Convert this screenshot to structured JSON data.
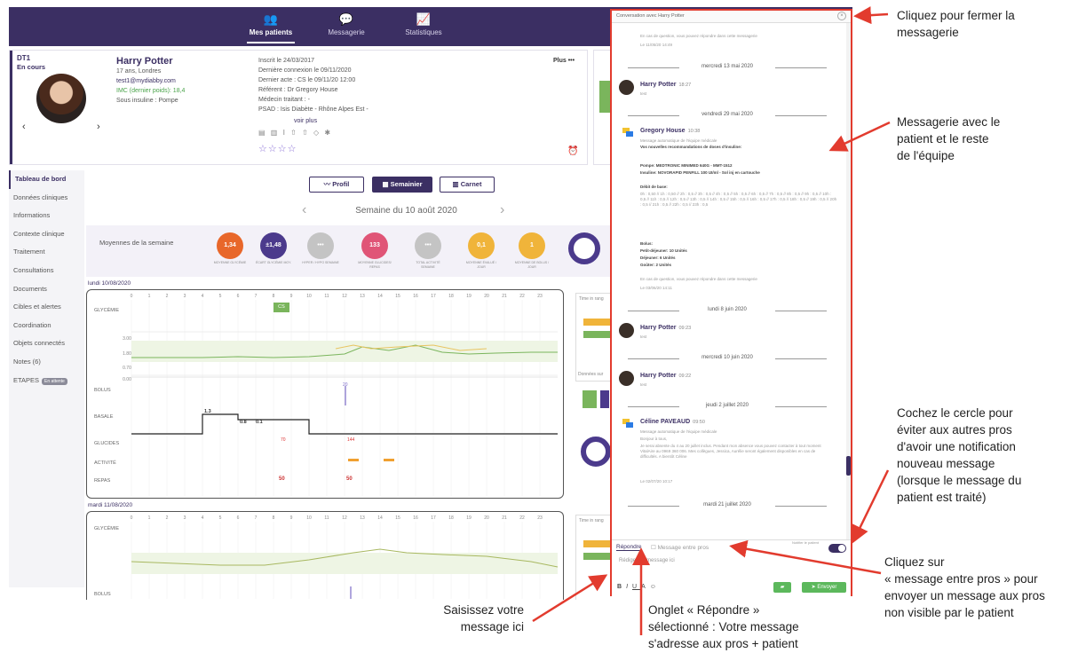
{
  "nav": {
    "tabs": [
      {
        "label": "Mes patients",
        "icon": "patients-icon"
      },
      {
        "label": "Messagerie",
        "icon": "chat-icon"
      },
      {
        "label": "Statistiques",
        "icon": "stats-icon"
      }
    ]
  },
  "patient": {
    "type": "DT1",
    "status": "En cours",
    "name": "Harry Potter",
    "age_city": "17 ans, Londres",
    "email": "test1@mydiabby.com",
    "imc": "IMC (dernier poids): 18,4",
    "insulin": "Sous insuline : Pompe",
    "inscrit": "Inscrit le 24/03/2017",
    "last_connection": "Dernière connexion le 09/11/2020",
    "last_act": "Dernier acte : CS le 09/11/20 12:00",
    "referent": "Référent : Dr Gregory House",
    "medecin": "Médecin traitant : -",
    "psad": "PSAD :     Isis Diabète - Rhône Alpes Est -",
    "voir_plus": "voir plus",
    "plus": "Plus •••"
  },
  "sidebar": {
    "items": [
      {
        "label": "Tableau de bord"
      },
      {
        "label": "Données cliniques"
      },
      {
        "label": "Informations"
      },
      {
        "label": "Contexte clinique"
      },
      {
        "label": "Traitement"
      },
      {
        "label": "Consultations"
      },
      {
        "label": "Documents"
      },
      {
        "label": "Cibles et alertes"
      },
      {
        "label": "Coordination"
      },
      {
        "label": "Objets connectés"
      },
      {
        "label": "Notes (6)"
      },
      {
        "label": "ETAPES",
        "badge": "En attente"
      }
    ]
  },
  "dashboard": {
    "buttons": {
      "profil": "Profil",
      "semainier": "Semainier",
      "carnet": "Carnet"
    },
    "week": "Semaine du 10 août 2020",
    "averages_label": "Moyennes de la semaine",
    "circles": [
      {
        "value": "1,34",
        "unit": "g/l",
        "color": "#e8672a",
        "label": "MOYENNE GLYCÉMIE"
      },
      {
        "value": "±1,48",
        "unit": "g/l",
        "color": "#4b3a8c",
        "label": "ÉCART GLYCÉMIE MOY."
      },
      {
        "value": "•••",
        "unit": "",
        "color": "#c4c4c4",
        "label": "HYPER / HYPO SEMAINE"
      },
      {
        "value": "133",
        "unit": "g",
        "color": "#e05577",
        "label": "MOYENNE GLUCIDES/ REPAS"
      },
      {
        "value": "•••",
        "unit": "",
        "color": "#c4c4c4",
        "label": "TOTAL ACTIVITÉ SEMAINE"
      },
      {
        "value": "0,1",
        "unit": "",
        "color": "#f0b43a",
        "label": "MOYENNE ÉVALUÉ / JOUR"
      },
      {
        "value": "1",
        "unit": "",
        "color": "#f0b43a",
        "label": "MOYENNE DE BOLUS / JOUR"
      }
    ],
    "days": [
      {
        "date": "lundi 10/08/2020"
      },
      {
        "date": "mardi 11/08/2020"
      }
    ],
    "hours": [
      "0",
      "1",
      "2",
      "3",
      "4",
      "5",
      "6",
      "7",
      "8",
      "9",
      "10",
      "11",
      "12",
      "13",
      "14",
      "15",
      "16",
      "17",
      "18",
      "19",
      "20",
      "21",
      "22",
      "23"
    ],
    "rows": [
      "GLYCÉMIE",
      "BOLUS",
      "BASALE",
      "GLUCIDES",
      "ACTIVITÉ",
      "REPAS"
    ],
    "gly_ticks": [
      "3.00",
      "1.80",
      "0.70",
      "0.00"
    ],
    "badge_cs": "CS",
    "basale_vals": [
      "1.3",
      "0.8",
      "0.1"
    ],
    "bolus_val": "20",
    "glucides_vals": [
      "70",
      "144"
    ],
    "repas_label": "50",
    "right_labels": {
      "time": "Time in rang",
      "donnees": "Données sur"
    }
  },
  "messagerie": {
    "title": "Conversation avec Harry Potter",
    "top_text": "En cas de question, vous pouvez répondre dans cette messagerie",
    "top_date": "Le 11/05/20 14:49",
    "messages": [
      {
        "sep": "mercredi 13 mai 2020",
        "author": "Harry Potter",
        "time": "18:27",
        "text": "test"
      },
      {
        "sep": "vendredi 29 mai 2020",
        "author": "Gregory House",
        "time": "10:38",
        "text": "Message automatique de l'équipe médicale",
        "bold": "Vos nouvelles recommandations de doses d'insuline:"
      },
      {
        "sep": "lundi 8 juin 2020",
        "author": "Harry Potter",
        "time": "09:23",
        "text": "test"
      },
      {
        "sep": "mercredi 10 juin 2020",
        "author": "Harry Potter",
        "time": "09:22",
        "text": "test"
      },
      {
        "sep": "jeudi 2 juillet 2020",
        "author": "Céline PAVEAUD",
        "time": "09:50",
        "text": "Message automatique de l'équipe médicale"
      },
      {
        "sep": "mardi 21 juillet 2020"
      }
    ],
    "house_details": {
      "pompe": "Pompe: MEDTRONIC MINIMED 640G - MMT-1512",
      "insuline": "Insuline: NOVORAPID PENFILL 100 UI/ml - Sol inj en cartouche",
      "debit_title": "Débit de base:",
      "debit_text": "0h : 0,50 // 1h : 0,50 // 2h : 0,5 // 3h : 0,5 // 4h : 0,5 // 5h : 0,5 // 6h : 0,5 // 7h : 0,5 // 8h : 0,5 // 9h : 0,5 // 10h : 0,5 // 11h : 0,5 // 12h : 0,5 // 13h : 0,5 // 14h : 0,5 // 15h : 0,5 // 16h : 0,5 // 17h : 0,5 // 18h : 0,5 // 19h : 0,5 // 20h : 0,5 // 21h : 0,5 // 22h : 0,5 // 23h : 0,5",
      "bolus_title": "Bolus:",
      "petit": "Petit-déjeuner: 10 Unités",
      "dejeuner": "Déjeuner: 6 Unités",
      "gouter": "Goûter: 2 Unités",
      "footer": "En cas de question, vous pouvez répondre dans cette messagerie",
      "date": "Le 03/06/20 14:11"
    },
    "celine_details": {
      "l1": "Bonjour à tous,",
      "l2": "Je serai absente du 4 au 20 juillet inclus. Pendant mon absence vous pouvez contacter à tout moment VitalAire au 0969 360 006. Mes collègues, Jessica, Aurélie seront également disponibles en cas de difficultés. A bientôt Céline",
      "date": "Le 02/07/20 10:17"
    },
    "tabs": {
      "repondre": "Répondre",
      "pros": "Message entre pros"
    },
    "toggle_label": "Notifier le patient",
    "input_placeholder": "Rédiger un message ici",
    "send": "Envoyer"
  },
  "annotations": {
    "close": [
      "Cliquez pour fermer la",
      "messagerie"
    ],
    "team": [
      "Messagerie avec le",
      "patient et le reste",
      "de l'équipe"
    ],
    "circle": [
      "Cochez le cercle pour",
      "éviter aux autres pros",
      "d'avoir une notification",
      "nouveau message",
      "(lorsque le message du",
      "patient est traité)"
    ],
    "pros": [
      "Cliquez sur",
      "« message entre pros » pour",
      "envoyer un message aux pros",
      "non visible par le patient"
    ],
    "input": [
      "Saisissez votre",
      "message ici"
    ],
    "onglet": [
      "Onglet « Répondre »",
      "sélectionné : Votre message",
      "s'adresse aux pros + patient"
    ]
  }
}
